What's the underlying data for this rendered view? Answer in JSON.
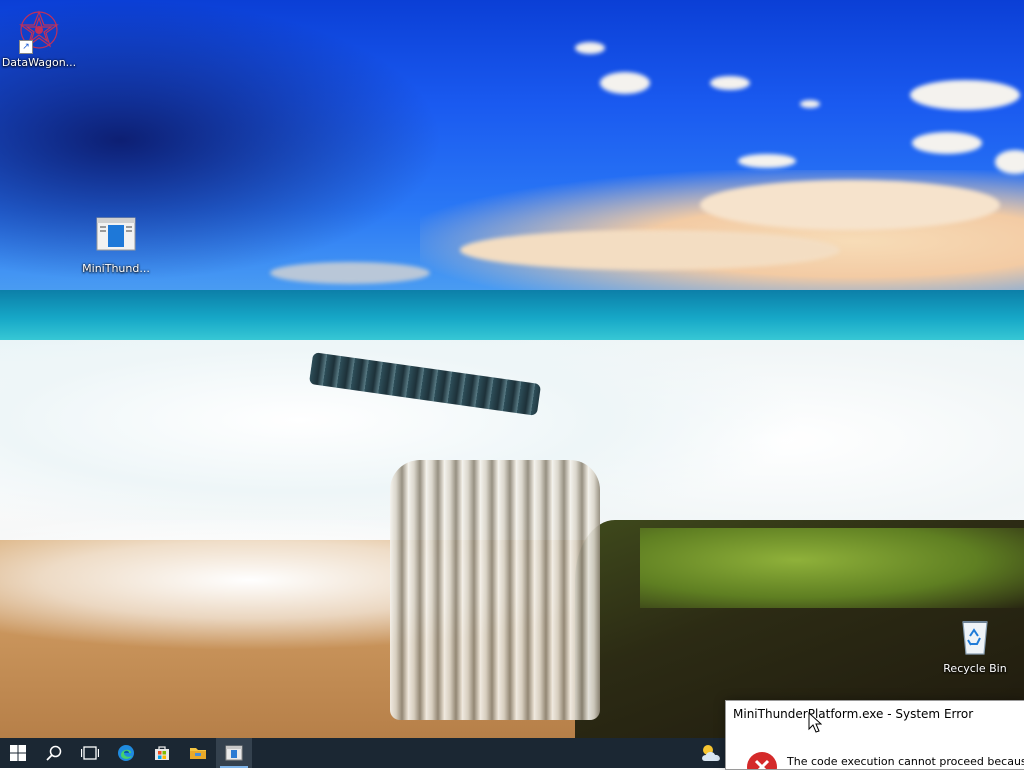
{
  "desktop": {
    "icons": [
      {
        "label": "DataWagon..."
      },
      {
        "label": "MiniThund..."
      },
      {
        "label": "Recycle Bin"
      }
    ]
  },
  "taskbar": {
    "buttons": [
      "windows-logo",
      "search",
      "task-view",
      "edge",
      "store",
      "file-explorer",
      "minithunder-app"
    ],
    "weather_icon": "cloud-sun-icon"
  },
  "dialog": {
    "title": "MiniThunderPlatform.exe - System Error",
    "message": "The code execution cannot proceed because M"
  },
  "colors": {
    "taskbar": "#1b2733",
    "active_indicator": "#7eb4ea",
    "error_red": "#d42a2a"
  }
}
